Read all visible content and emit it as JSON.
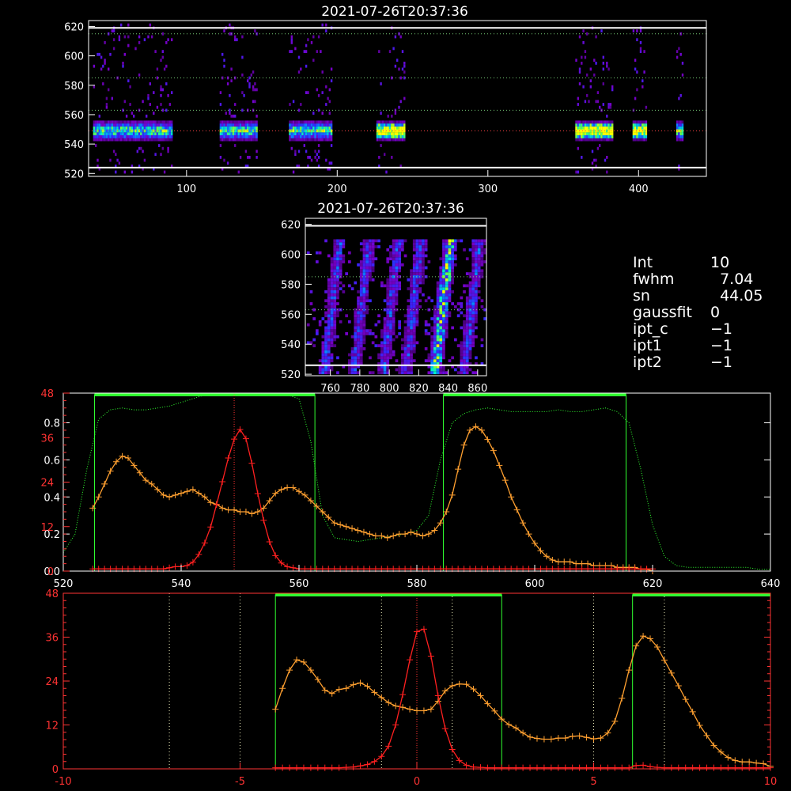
{
  "chart_data": [
    {
      "id": "spectrogram_top",
      "type": "heatmap",
      "title": "2021-07-26T20:37:36",
      "xlim": [
        35,
        445
      ],
      "ylim": [
        518,
        624
      ],
      "xticks": [
        100,
        200,
        300,
        400
      ],
      "yticks": [
        520,
        540,
        560,
        580,
        600,
        620
      ],
      "hlines_white": [
        619,
        524
      ],
      "hlines_dotted_green": [
        615,
        585,
        563
      ],
      "hline_dotted_red": 549,
      "bursts": [
        [
          38,
          90
        ],
        [
          122,
          147
        ],
        [
          168,
          196
        ],
        [
          226,
          245
        ],
        [
          358,
          383
        ],
        [
          396,
          405
        ],
        [
          425,
          429
        ]
      ]
    },
    {
      "id": "spectrogram_zoom",
      "type": "heatmap",
      "title": "2021-07-26T20:37:36",
      "xlim": [
        743,
        866
      ],
      "ylim": [
        519,
        624
      ],
      "xticks": [
        760,
        780,
        800,
        820,
        840,
        860
      ],
      "yticks": [
        520,
        540,
        560,
        580,
        600,
        620
      ],
      "hlines_white": [
        619,
        526
      ],
      "hlines_dotted_green": [
        585,
        563
      ],
      "streaks": [
        755,
        775,
        795,
        810,
        830,
        850
      ]
    },
    {
      "id": "profile_top",
      "type": "line",
      "xlim": [
        520,
        640
      ],
      "xticks": [
        520,
        540,
        560,
        580,
        600,
        620,
        640
      ],
      "y_left_white_ticks": [
        0.0,
        0.2,
        0.4,
        0.6,
        0.8
      ],
      "y_left_red_ticks": [
        0,
        12,
        24,
        36,
        48
      ],
      "y_left_white_lim": [
        0,
        0.96
      ],
      "y_left_red_lim": [
        0,
        48
      ],
      "green_bands": [
        [
          525.3,
          562.7
        ],
        [
          584.5,
          615.5
        ]
      ],
      "vline_red_dotted": 549,
      "series": [
        {
          "color": "#FFA030",
          "x": [
            525,
            526,
            527,
            528,
            529,
            530,
            531,
            532,
            533,
            534,
            535,
            536,
            537,
            538,
            539,
            540,
            541,
            542,
            543,
            544,
            545,
            546,
            547,
            548,
            549,
            550,
            551,
            552,
            553,
            554,
            555,
            556,
            557,
            558,
            559,
            560,
            561,
            562,
            563,
            564,
            565,
            566,
            567,
            568,
            569,
            570,
            571,
            572,
            573,
            574,
            575,
            576,
            577,
            578,
            579,
            580,
            581,
            582,
            583,
            584,
            585,
            586,
            587,
            588,
            589,
            590,
            591,
            592,
            593,
            594,
            595,
            596,
            597,
            598,
            599,
            600,
            601,
            602,
            603,
            604,
            605,
            606,
            607,
            608,
            609,
            610,
            611,
            612,
            613,
            614,
            615,
            616,
            617,
            618,
            619,
            620
          ],
          "y": [
            0.34,
            0.4,
            0.47,
            0.54,
            0.59,
            0.62,
            0.61,
            0.57,
            0.53,
            0.49,
            0.47,
            0.44,
            0.41,
            0.4,
            0.41,
            0.42,
            0.43,
            0.44,
            0.42,
            0.4,
            0.37,
            0.36,
            0.34,
            0.33,
            0.33,
            0.32,
            0.32,
            0.31,
            0.32,
            0.34,
            0.38,
            0.42,
            0.44,
            0.45,
            0.45,
            0.43,
            0.41,
            0.38,
            0.35,
            0.32,
            0.29,
            0.26,
            0.25,
            0.24,
            0.23,
            0.22,
            0.21,
            0.2,
            0.19,
            0.19,
            0.18,
            0.19,
            0.2,
            0.2,
            0.21,
            0.2,
            0.19,
            0.2,
            0.22,
            0.26,
            0.32,
            0.41,
            0.55,
            0.68,
            0.76,
            0.78,
            0.76,
            0.71,
            0.65,
            0.57,
            0.49,
            0.4,
            0.33,
            0.26,
            0.2,
            0.15,
            0.11,
            0.08,
            0.06,
            0.05,
            0.05,
            0.05,
            0.04,
            0.04,
            0.04,
            0.03,
            0.03,
            0.03,
            0.03,
            0.02,
            0.02,
            0.02,
            0.02,
            0.01,
            0.01,
            0.0
          ]
        },
        {
          "color": "#FF2020",
          "x": [
            525,
            526,
            527,
            528,
            529,
            530,
            531,
            532,
            533,
            534,
            535,
            536,
            537,
            538,
            539,
            540,
            541,
            542,
            543,
            544,
            545,
            546,
            547,
            548,
            549,
            550,
            551,
            552,
            553,
            554,
            555,
            556,
            557,
            558,
            559,
            560,
            561,
            562,
            563,
            564,
            565,
            566,
            567,
            568,
            569,
            570,
            571,
            572,
            573,
            574,
            575,
            576,
            577,
            578,
            579,
            580,
            581,
            582,
            583,
            584,
            585,
            586,
            587,
            588,
            589,
            590,
            591,
            592,
            593,
            594,
            595,
            596,
            597,
            598,
            599,
            600,
            601,
            602,
            603,
            604,
            605,
            606,
            607,
            608,
            609,
            610,
            611,
            612,
            613,
            614,
            615,
            616,
            617,
            618,
            619,
            620
          ],
          "y": [
            0.6,
            0.6,
            0.6,
            0.6,
            0.6,
            0.6,
            0.6,
            0.6,
            0.6,
            0.6,
            0.6,
            0.6,
            0.6,
            0.9,
            1.2,
            1.2,
            1.5,
            2.4,
            4.5,
            7.6,
            11.9,
            17.9,
            24.1,
            30.5,
            35.6,
            38.2,
            35.7,
            29.1,
            20.9,
            13.7,
            7.9,
            4.2,
            2.2,
            1.2,
            0.9,
            0.6,
            0.6,
            0.6,
            0.6,
            0.6,
            0.6,
            0.6,
            0.6,
            0.6,
            0.6,
            0.6,
            0.6,
            0.6,
            0.6,
            0.6,
            0.6,
            0.6,
            0.6,
            0.6,
            0.6,
            0.6,
            0.6,
            0.6,
            0.6,
            0.6,
            0.6,
            0.6,
            0.6,
            0.6,
            0.6,
            0.6,
            0.6,
            0.6,
            0.6,
            0.6,
            0.6,
            0.6,
            0.6,
            0.6,
            0.6,
            0.6,
            0.6,
            0.6,
            0.6,
            0.6,
            0.6,
            0.6,
            0.6,
            0.6,
            0.6,
            0.6,
            0.6,
            0.6,
            0.6,
            0.6,
            0.6,
            0.6,
            0.6,
            0.6,
            0.6,
            0.6
          ]
        },
        {
          "color": "#30FF30",
          "dotted": true,
          "x": [
            520,
            522,
            524,
            526,
            528,
            530,
            532,
            534,
            536,
            538,
            540,
            542,
            544,
            546,
            548,
            550,
            552,
            554,
            556,
            558,
            560,
            562,
            564,
            566,
            568,
            570,
            572,
            574,
            576,
            578,
            580,
            582,
            584,
            586,
            588,
            590,
            592,
            594,
            596,
            598,
            600,
            602,
            604,
            606,
            608,
            610,
            612,
            614,
            616,
            618,
            620,
            622,
            624,
            626,
            628,
            630,
            632,
            634,
            636,
            638,
            640
          ],
          "y": [
            0.1,
            0.2,
            0.55,
            0.82,
            0.87,
            0.88,
            0.87,
            0.87,
            0.88,
            0.89,
            0.91,
            0.93,
            0.95,
            0.96,
            0.96,
            0.95,
            0.95,
            0.96,
            0.96,
            0.95,
            0.93,
            0.7,
            0.3,
            0.18,
            0.17,
            0.16,
            0.17,
            0.18,
            0.19,
            0.2,
            0.22,
            0.3,
            0.6,
            0.8,
            0.85,
            0.87,
            0.88,
            0.87,
            0.86,
            0.86,
            0.86,
            0.86,
            0.87,
            0.86,
            0.86,
            0.87,
            0.88,
            0.86,
            0.8,
            0.55,
            0.25,
            0.08,
            0.03,
            0.02,
            0.02,
            0.02,
            0.02,
            0.02,
            0.02,
            0.01,
            0.01
          ]
        }
      ]
    },
    {
      "id": "profile_bottom",
      "type": "line",
      "xlim": [
        -10,
        10
      ],
      "xticks": [
        -10,
        -5,
        0,
        5,
        10
      ],
      "yticks": [
        0,
        12,
        24,
        36,
        48
      ],
      "ylim": [
        0,
        48
      ],
      "green_bands": [
        [
          -4,
          2.4
        ],
        [
          6.1,
          10
        ]
      ],
      "vlines_white_dotted": [
        -7,
        -5,
        -1,
        1,
        5,
        7
      ],
      "vline_red_dotted": 0,
      "series": [
        {
          "color": "#FFA030",
          "x": [
            -4.0,
            -3.8,
            -3.6,
            -3.4,
            -3.2,
            -3.0,
            -2.8,
            -2.6,
            -2.4,
            -2.2,
            -2.0,
            -1.8,
            -1.6,
            -1.4,
            -1.2,
            -1.0,
            -0.8,
            -0.6,
            -0.4,
            -0.2,
            0.0,
            0.2,
            0.4,
            0.6,
            0.8,
            1.0,
            1.2,
            1.4,
            1.6,
            1.8,
            2.0,
            2.2,
            2.4,
            2.6,
            2.8,
            3.0,
            3.2,
            3.4,
            3.6,
            3.8,
            4.0,
            4.2,
            4.4,
            4.6,
            4.8,
            5.0,
            5.2,
            5.4,
            5.6,
            5.8,
            6.0,
            6.2,
            6.4,
            6.6,
            6.8,
            7.0,
            7.2,
            7.4,
            7.6,
            7.8,
            8.0,
            8.2,
            8.4,
            8.6,
            8.8,
            9.0,
            9.2,
            9.4,
            9.6,
            9.8,
            10.0
          ],
          "y": [
            16.3,
            22,
            27,
            29.8,
            29.2,
            27,
            24.4,
            21.5,
            20.6,
            21.7,
            22,
            23,
            23.5,
            22.6,
            20.9,
            19.5,
            18.1,
            17.2,
            16.8,
            16.3,
            15.9,
            15.9,
            16.3,
            18.5,
            21.3,
            22.7,
            23.2,
            23.1,
            21.8,
            20,
            17.8,
            15.8,
            13.6,
            12.1,
            11.2,
            9.8,
            8.7,
            8.3,
            8.1,
            8.1,
            8.4,
            8.4,
            8.9,
            9,
            8.6,
            8.2,
            8.4,
            9.8,
            13,
            19.3,
            27,
            33.6,
            36.3,
            35.6,
            33.3,
            29.7,
            26.2,
            22.7,
            19,
            15.6,
            11.9,
            9.1,
            6.4,
            4.6,
            3.1,
            2.3,
            1.9,
            1.9,
            1.6,
            1.4,
            0.7
          ]
        },
        {
          "color": "#FF2020",
          "x": [
            -4.0,
            -3.8,
            -3.6,
            -3.4,
            -3.2,
            -3.0,
            -2.8,
            -2.6,
            -2.4,
            -2.2,
            -2.0,
            -1.8,
            -1.6,
            -1.4,
            -1.2,
            -1.0,
            -0.8,
            -0.6,
            -0.4,
            -0.2,
            0.0,
            0.2,
            0.4,
            0.6,
            0.8,
            1.0,
            1.2,
            1.4,
            1.6,
            1.8,
            2.0,
            2.2,
            2.4,
            2.6,
            2.8,
            3.0,
            3.2,
            3.4,
            3.6,
            3.8,
            4.0,
            4.2,
            4.4,
            4.6,
            4.8,
            5.0,
            5.2,
            5.4,
            5.6,
            5.8,
            6.0,
            6.2,
            6.4,
            6.6,
            6.8,
            7.0,
            7.2,
            7.4,
            7.6,
            7.8,
            8.0,
            8.2,
            8.4,
            8.6,
            8.8,
            9.0,
            9.2,
            9.4,
            9.6,
            9.8,
            10.0
          ],
          "y": [
            0.3,
            0.3,
            0.3,
            0.3,
            0.3,
            0.3,
            0.3,
            0.3,
            0.3,
            0.3,
            0.4,
            0.5,
            0.8,
            1.2,
            2.0,
            3.4,
            6.2,
            12.0,
            20.3,
            29.8,
            37.5,
            38.2,
            30.8,
            20.0,
            11.0,
            5.3,
            2.3,
            1.0,
            0.5,
            0.4,
            0.3,
            0.3,
            0.3,
            0.3,
            0.3,
            0.3,
            0.3,
            0.3,
            0.3,
            0.3,
            0.3,
            0.3,
            0.3,
            0.3,
            0.3,
            0.3,
            0.3,
            0.3,
            0.3,
            0.3,
            0.3,
            0.9,
            1.0,
            0.6,
            0.4,
            0.3,
            0.3,
            0.3,
            0.3,
            0.3,
            0.3,
            0.3,
            0.3,
            0.3,
            0.3,
            0.3,
            0.3,
            0.3,
            0.3,
            0.3,
            0.3
          ]
        }
      ]
    }
  ],
  "readout": [
    {
      "key": "Int",
      "value": "10"
    },
    {
      "key": "fwhm",
      "value": "  7.04"
    },
    {
      "key": "sn",
      "value": "  44.05"
    },
    {
      "key": "gaussfit",
      "value": "0"
    },
    {
      "key": "ipt_c",
      "value": "−1"
    },
    {
      "key": "ipt1",
      "value": "−1"
    },
    {
      "key": "ipt2",
      "value": "−1"
    }
  ]
}
